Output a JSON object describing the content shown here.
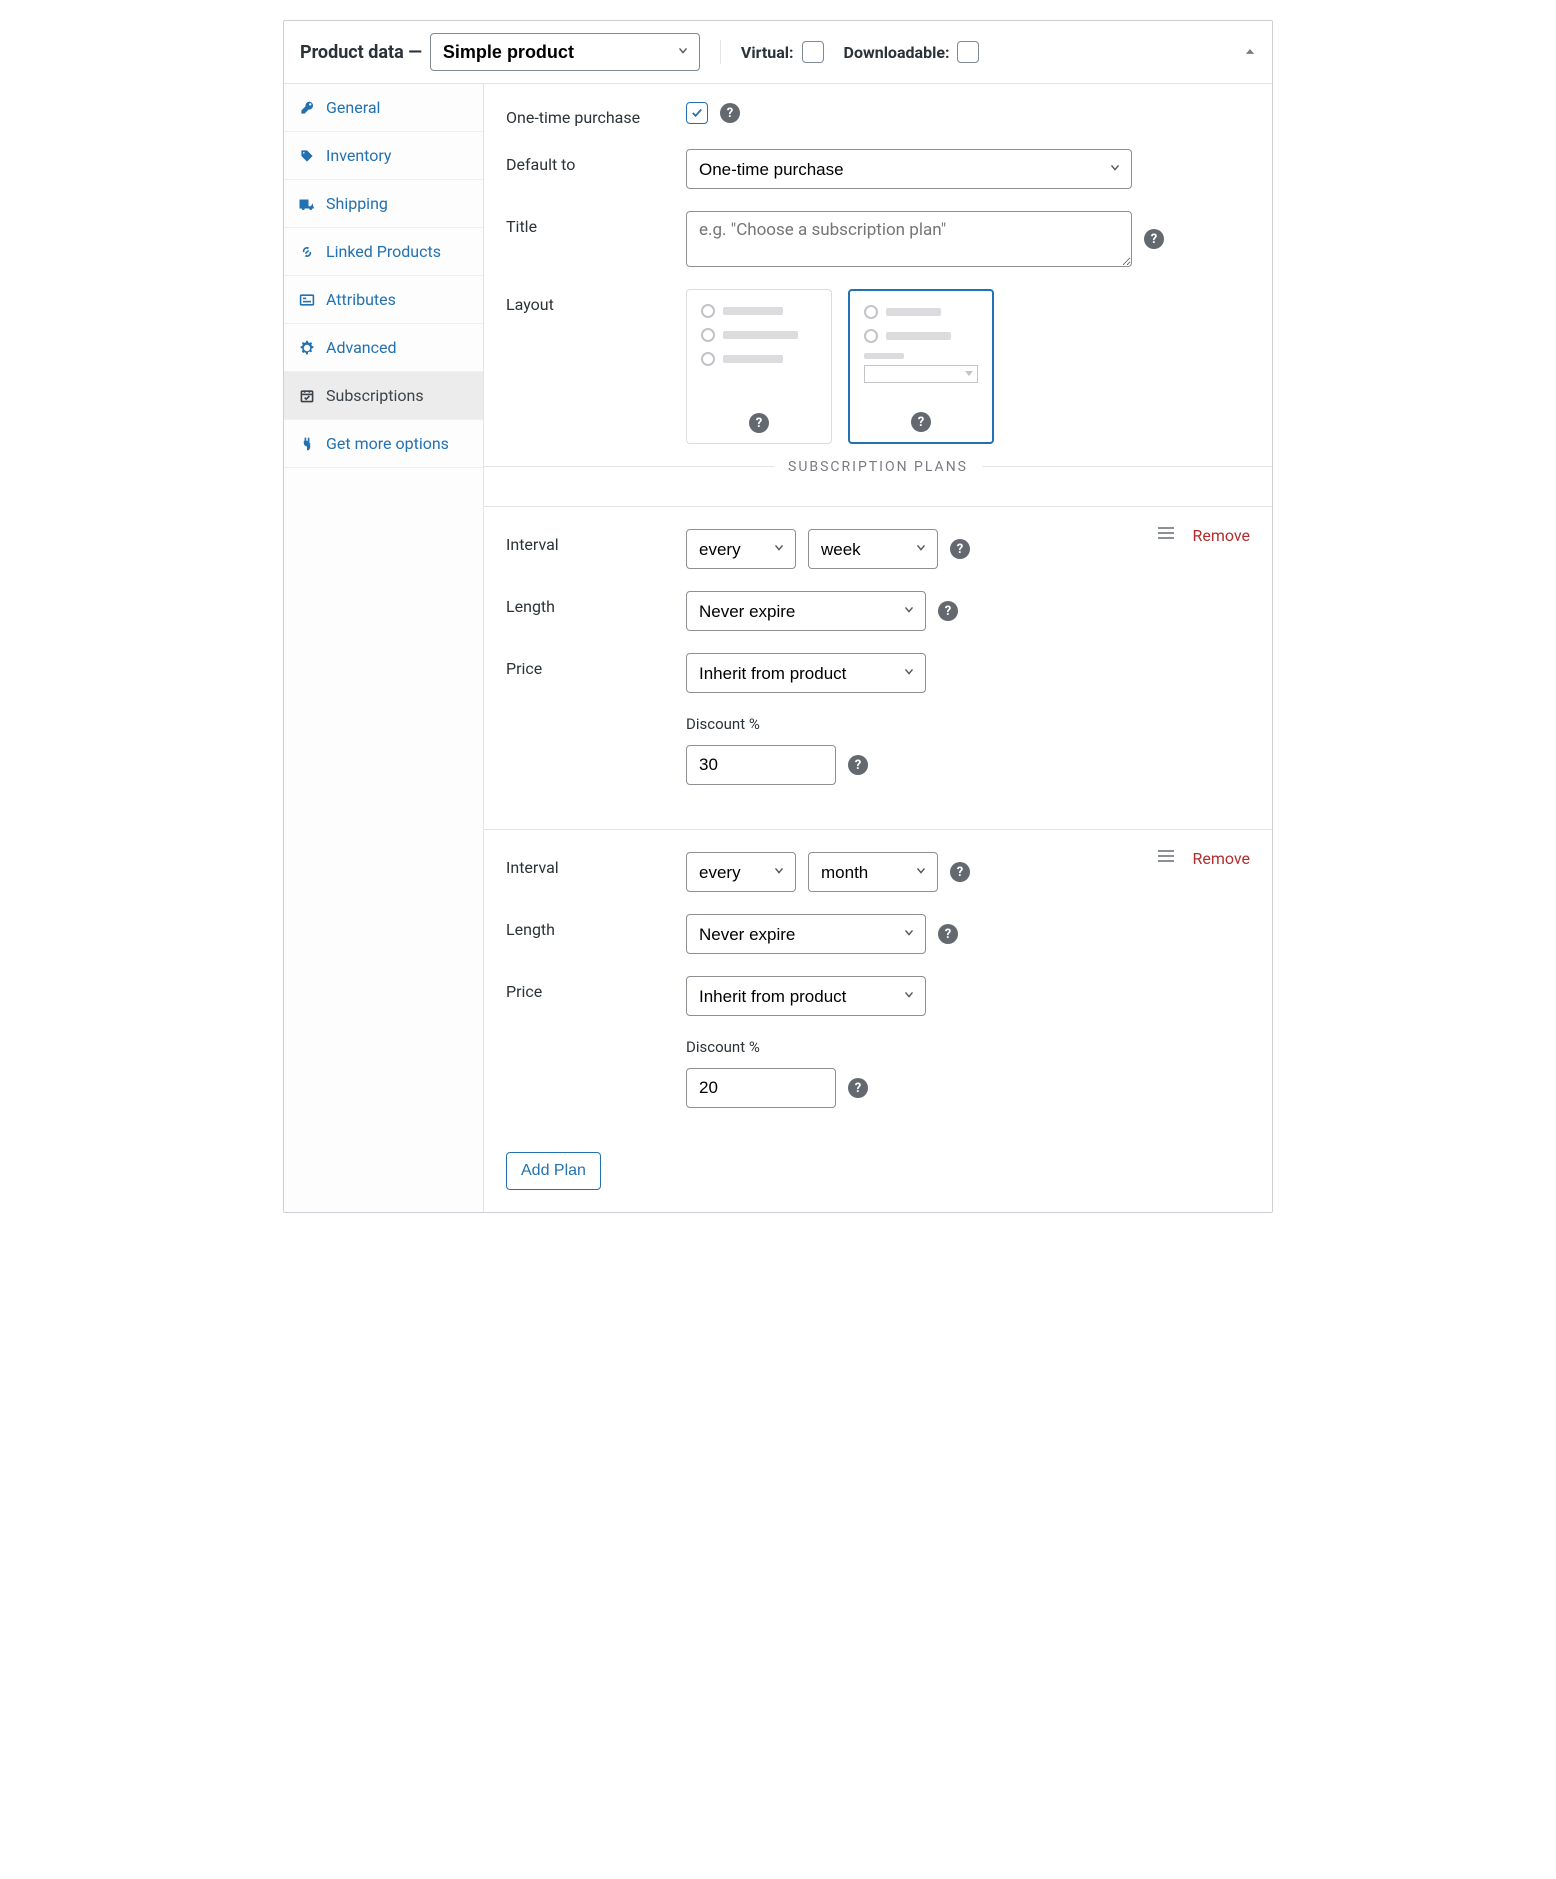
{
  "header": {
    "title": "Product data —",
    "product_type": "Simple product",
    "virtual_label": "Virtual:",
    "downloadable_label": "Downloadable:",
    "virtual_checked": false,
    "downloadable_checked": false
  },
  "sidebar": {
    "items": [
      {
        "label": "General",
        "icon": "wrench"
      },
      {
        "label": "Inventory",
        "icon": "tag"
      },
      {
        "label": "Shipping",
        "icon": "truck"
      },
      {
        "label": "Linked Products",
        "icon": "link"
      },
      {
        "label": "Attributes",
        "icon": "id"
      },
      {
        "label": "Advanced",
        "icon": "gear"
      },
      {
        "label": "Subscriptions",
        "icon": "calendar",
        "active": true
      },
      {
        "label": "Get more options",
        "icon": "plug"
      }
    ]
  },
  "fields": {
    "one_time_label": "One-time purchase",
    "one_time_checked": true,
    "default_to_label": "Default to",
    "default_to_value": "One-time purchase",
    "title_label": "Title",
    "title_placeholder": "e.g. \"Choose a subscription plan\"",
    "title_value": "",
    "layout_label": "Layout",
    "layout_selected_index": 1
  },
  "section_divider": "SUBSCRIPTION PLANS",
  "plans": [
    {
      "interval_label": "Interval",
      "interval_freq": "every",
      "interval_unit": "week",
      "length_label": "Length",
      "length_value": "Never expire",
      "price_label": "Price",
      "price_value": "Inherit from product",
      "discount_label": "Discount %",
      "discount_value": "30",
      "remove_label": "Remove"
    },
    {
      "interval_label": "Interval",
      "interval_freq": "every",
      "interval_unit": "month",
      "length_label": "Length",
      "length_value": "Never expire",
      "price_label": "Price",
      "price_value": "Inherit from product",
      "discount_label": "Discount %",
      "discount_value": "20",
      "remove_label": "Remove"
    }
  ],
  "add_plan_label": "Add Plan"
}
